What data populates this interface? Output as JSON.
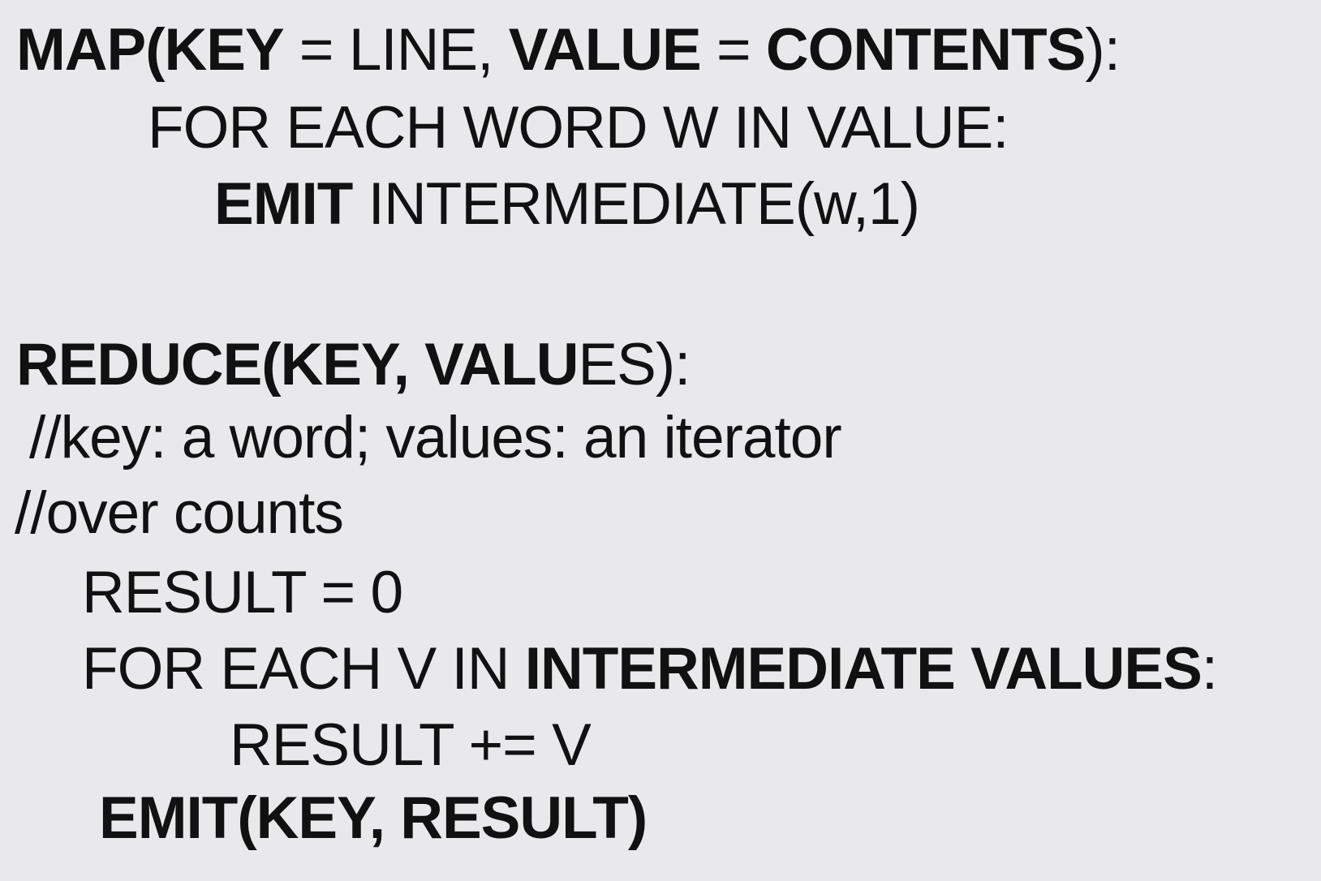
{
  "code": {
    "map_line": {
      "p1": "MAP(KEY",
      "p2": " = LINE, ",
      "p3": "VALUE",
      "p4": " = ",
      "p5": "CONTENTS",
      "p6": "):"
    },
    "foreach_word_line": "FOR EACH WORD W IN VALUE:",
    "emit_intermediate_line": {
      "p1": "EMIT",
      "p2": " INTERMEDIATE(w,1)"
    },
    "reduce_line": {
      "p1": "REDUCE(KEY, VALU",
      "p2": "ES):"
    },
    "comment_line_1": "//key: a word; values: an iterator",
    "comment_line_2": "//over counts",
    "result_init_line": "RESULT = 0",
    "foreach_value_line": {
      "p1": "FOR EACH V IN ",
      "p2": "INTERMEDIATE VALUES",
      "p3": ":"
    },
    "result_add_line": "RESULT += V",
    "emit_result_line": "EMIT(KEY, RESULT)"
  }
}
